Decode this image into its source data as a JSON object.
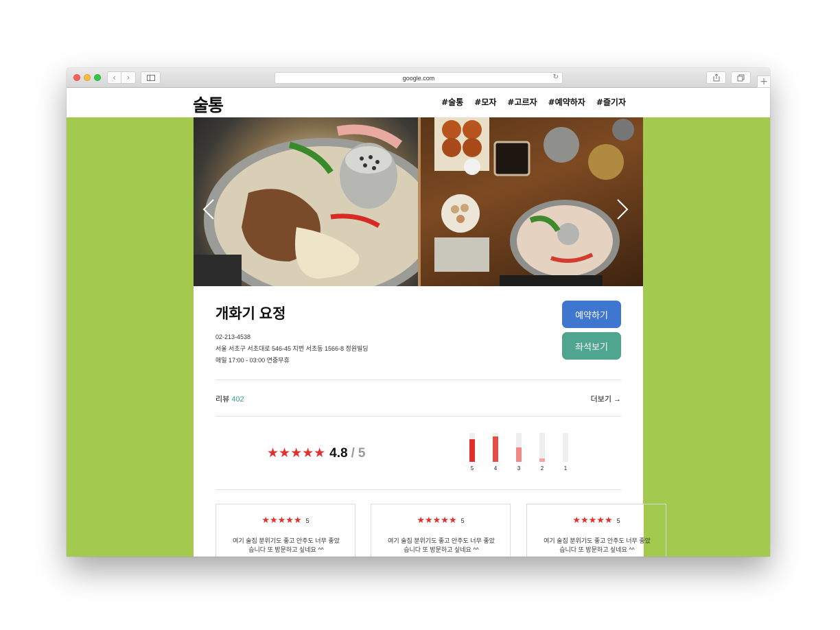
{
  "browser": {
    "url": "google.com",
    "back_glyph": "‹",
    "forward_glyph": "›",
    "reload_glyph": "↻",
    "new_tab_glyph": "+"
  },
  "site": {
    "logo": "술통",
    "nav": [
      "#술통",
      "#모자",
      "#고르자",
      "#예약하자",
      "#즐기자"
    ],
    "accent_color": "#a3ca4f"
  },
  "store": {
    "name": "개화기 요정",
    "phone": "02-213-4538",
    "address": "서울 서초구 서초대로 546-45 지번 서초동 1566-8 정원빌딩",
    "hours": "매일 17:00 - 03:00 연중무휴"
  },
  "actions": {
    "reserve_label": "예약하기",
    "seat_label": "좌석보기"
  },
  "reviews": {
    "label": "리뷰",
    "count": "402",
    "more_label": "더보기 →"
  },
  "rating": {
    "stars": "★★★★★",
    "score": "4.8",
    "separator": "/",
    "max": "5",
    "histogram": [
      {
        "label": "5",
        "fraction": 0.78,
        "color": "#e4302b"
      },
      {
        "label": "4",
        "fraction": 0.88,
        "color": "#e54f4a"
      },
      {
        "label": "3",
        "fraction": 0.5,
        "color": "#ef8a86"
      },
      {
        "label": "2",
        "fraction": 0.12,
        "color": "#f3a6a2"
      },
      {
        "label": "1",
        "fraction": 0.0,
        "color": "#f3a6a2"
      }
    ]
  },
  "review_cards": [
    {
      "stars": "★★★★★",
      "score": "5",
      "text": "여기 술집 분위기도 좋고 안주도 너무 좋았습니다 또 방문하고 싶네요 ^^"
    },
    {
      "stars": "★★★★★",
      "score": "5",
      "text": "여기 술집 분위기도 좋고 안주도 너무 좋았습니다 또 방문하고 싶네요 ^^"
    },
    {
      "stars": "★★★★★",
      "score": "5",
      "text": "여기 술집 분위기도 좋고 안주도 너무 좋았습니다 또 방문하고 싶네요 ^^"
    }
  ]
}
